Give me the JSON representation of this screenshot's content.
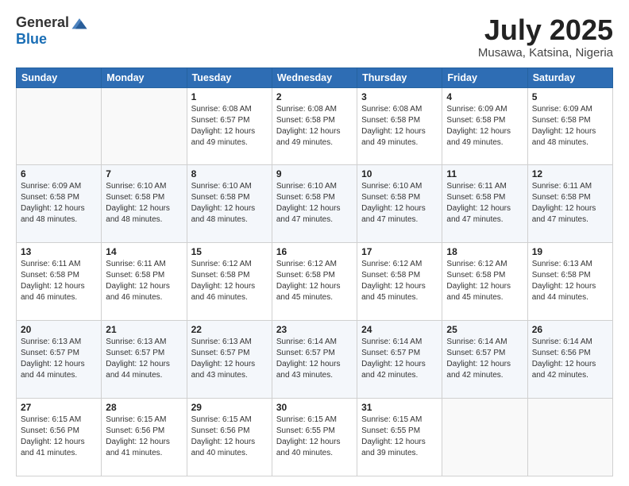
{
  "header": {
    "logo_general": "General",
    "logo_blue": "Blue",
    "month_title": "July 2025",
    "location": "Musawa, Katsina, Nigeria"
  },
  "weekdays": [
    "Sunday",
    "Monday",
    "Tuesday",
    "Wednesday",
    "Thursday",
    "Friday",
    "Saturday"
  ],
  "weeks": [
    [
      {
        "day": "",
        "sunrise": "",
        "sunset": "",
        "daylight": ""
      },
      {
        "day": "",
        "sunrise": "",
        "sunset": "",
        "daylight": ""
      },
      {
        "day": "1",
        "sunrise": "Sunrise: 6:08 AM",
        "sunset": "Sunset: 6:57 PM",
        "daylight": "Daylight: 12 hours and 49 minutes."
      },
      {
        "day": "2",
        "sunrise": "Sunrise: 6:08 AM",
        "sunset": "Sunset: 6:58 PM",
        "daylight": "Daylight: 12 hours and 49 minutes."
      },
      {
        "day": "3",
        "sunrise": "Sunrise: 6:08 AM",
        "sunset": "Sunset: 6:58 PM",
        "daylight": "Daylight: 12 hours and 49 minutes."
      },
      {
        "day": "4",
        "sunrise": "Sunrise: 6:09 AM",
        "sunset": "Sunset: 6:58 PM",
        "daylight": "Daylight: 12 hours and 49 minutes."
      },
      {
        "day": "5",
        "sunrise": "Sunrise: 6:09 AM",
        "sunset": "Sunset: 6:58 PM",
        "daylight": "Daylight: 12 hours and 48 minutes."
      }
    ],
    [
      {
        "day": "6",
        "sunrise": "Sunrise: 6:09 AM",
        "sunset": "Sunset: 6:58 PM",
        "daylight": "Daylight: 12 hours and 48 minutes."
      },
      {
        "day": "7",
        "sunrise": "Sunrise: 6:10 AM",
        "sunset": "Sunset: 6:58 PM",
        "daylight": "Daylight: 12 hours and 48 minutes."
      },
      {
        "day": "8",
        "sunrise": "Sunrise: 6:10 AM",
        "sunset": "Sunset: 6:58 PM",
        "daylight": "Daylight: 12 hours and 48 minutes."
      },
      {
        "day": "9",
        "sunrise": "Sunrise: 6:10 AM",
        "sunset": "Sunset: 6:58 PM",
        "daylight": "Daylight: 12 hours and 47 minutes."
      },
      {
        "day": "10",
        "sunrise": "Sunrise: 6:10 AM",
        "sunset": "Sunset: 6:58 PM",
        "daylight": "Daylight: 12 hours and 47 minutes."
      },
      {
        "day": "11",
        "sunrise": "Sunrise: 6:11 AM",
        "sunset": "Sunset: 6:58 PM",
        "daylight": "Daylight: 12 hours and 47 minutes."
      },
      {
        "day": "12",
        "sunrise": "Sunrise: 6:11 AM",
        "sunset": "Sunset: 6:58 PM",
        "daylight": "Daylight: 12 hours and 47 minutes."
      }
    ],
    [
      {
        "day": "13",
        "sunrise": "Sunrise: 6:11 AM",
        "sunset": "Sunset: 6:58 PM",
        "daylight": "Daylight: 12 hours and 46 minutes."
      },
      {
        "day": "14",
        "sunrise": "Sunrise: 6:11 AM",
        "sunset": "Sunset: 6:58 PM",
        "daylight": "Daylight: 12 hours and 46 minutes."
      },
      {
        "day": "15",
        "sunrise": "Sunrise: 6:12 AM",
        "sunset": "Sunset: 6:58 PM",
        "daylight": "Daylight: 12 hours and 46 minutes."
      },
      {
        "day": "16",
        "sunrise": "Sunrise: 6:12 AM",
        "sunset": "Sunset: 6:58 PM",
        "daylight": "Daylight: 12 hours and 45 minutes."
      },
      {
        "day": "17",
        "sunrise": "Sunrise: 6:12 AM",
        "sunset": "Sunset: 6:58 PM",
        "daylight": "Daylight: 12 hours and 45 minutes."
      },
      {
        "day": "18",
        "sunrise": "Sunrise: 6:12 AM",
        "sunset": "Sunset: 6:58 PM",
        "daylight": "Daylight: 12 hours and 45 minutes."
      },
      {
        "day": "19",
        "sunrise": "Sunrise: 6:13 AM",
        "sunset": "Sunset: 6:58 PM",
        "daylight": "Daylight: 12 hours and 44 minutes."
      }
    ],
    [
      {
        "day": "20",
        "sunrise": "Sunrise: 6:13 AM",
        "sunset": "Sunset: 6:57 PM",
        "daylight": "Daylight: 12 hours and 44 minutes."
      },
      {
        "day": "21",
        "sunrise": "Sunrise: 6:13 AM",
        "sunset": "Sunset: 6:57 PM",
        "daylight": "Daylight: 12 hours and 44 minutes."
      },
      {
        "day": "22",
        "sunrise": "Sunrise: 6:13 AM",
        "sunset": "Sunset: 6:57 PM",
        "daylight": "Daylight: 12 hours and 43 minutes."
      },
      {
        "day": "23",
        "sunrise": "Sunrise: 6:14 AM",
        "sunset": "Sunset: 6:57 PM",
        "daylight": "Daylight: 12 hours and 43 minutes."
      },
      {
        "day": "24",
        "sunrise": "Sunrise: 6:14 AM",
        "sunset": "Sunset: 6:57 PM",
        "daylight": "Daylight: 12 hours and 42 minutes."
      },
      {
        "day": "25",
        "sunrise": "Sunrise: 6:14 AM",
        "sunset": "Sunset: 6:57 PM",
        "daylight": "Daylight: 12 hours and 42 minutes."
      },
      {
        "day": "26",
        "sunrise": "Sunrise: 6:14 AM",
        "sunset": "Sunset: 6:56 PM",
        "daylight": "Daylight: 12 hours and 42 minutes."
      }
    ],
    [
      {
        "day": "27",
        "sunrise": "Sunrise: 6:15 AM",
        "sunset": "Sunset: 6:56 PM",
        "daylight": "Daylight: 12 hours and 41 minutes."
      },
      {
        "day": "28",
        "sunrise": "Sunrise: 6:15 AM",
        "sunset": "Sunset: 6:56 PM",
        "daylight": "Daylight: 12 hours and 41 minutes."
      },
      {
        "day": "29",
        "sunrise": "Sunrise: 6:15 AM",
        "sunset": "Sunset: 6:56 PM",
        "daylight": "Daylight: 12 hours and 40 minutes."
      },
      {
        "day": "30",
        "sunrise": "Sunrise: 6:15 AM",
        "sunset": "Sunset: 6:55 PM",
        "daylight": "Daylight: 12 hours and 40 minutes."
      },
      {
        "day": "31",
        "sunrise": "Sunrise: 6:15 AM",
        "sunset": "Sunset: 6:55 PM",
        "daylight": "Daylight: 12 hours and 39 minutes."
      },
      {
        "day": "",
        "sunrise": "",
        "sunset": "",
        "daylight": ""
      },
      {
        "day": "",
        "sunrise": "",
        "sunset": "",
        "daylight": ""
      }
    ]
  ]
}
